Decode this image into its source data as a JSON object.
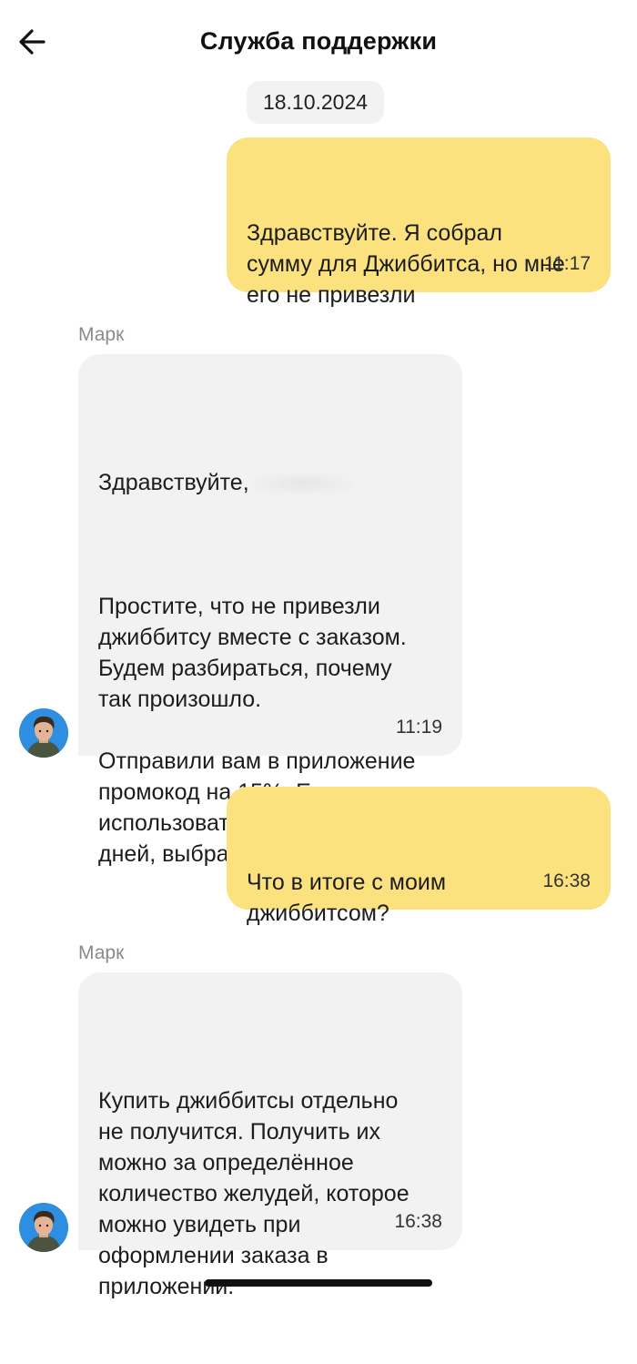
{
  "header": {
    "title": "Служба поддержки",
    "back_icon": "arrow-left-icon"
  },
  "date_separator": "18.10.2024",
  "messages": [
    {
      "direction": "outgoing",
      "text": "Здравствуйте. Я собрал\nсумму для Джиббитса, но мне\nего не привезли",
      "time": "11:17"
    },
    {
      "direction": "incoming",
      "sender": "Марк",
      "greeting": "Здравствуйте,",
      "text": "Простите, что не привезли\nджиббитсу вместе с заказом.\nБудем разбираться, почему\nтак произошло.\n\nОтправили вам в приложение\nпромокод на 15%. Его можно\nиспользовать в течение 30\nдней, выбрав перед оплатой.",
      "time": "11:19"
    },
    {
      "direction": "outgoing",
      "text": "Что в итоге с моим\nджиббитсом?",
      "time": "16:38"
    },
    {
      "direction": "incoming",
      "sender": "Марк",
      "text": "Купить джиббитсы отдельно\nне получится. Получить их\nможно за определённое\nколичество желудей, которое\nможно увидеть при\nоформлении заказа в\nприложении.",
      "time": "16:38"
    }
  ],
  "colors": {
    "outgoing_bubble": "#fbe27f",
    "incoming_bubble": "#f2f2f2",
    "avatar_background": "#2e8fe0"
  }
}
